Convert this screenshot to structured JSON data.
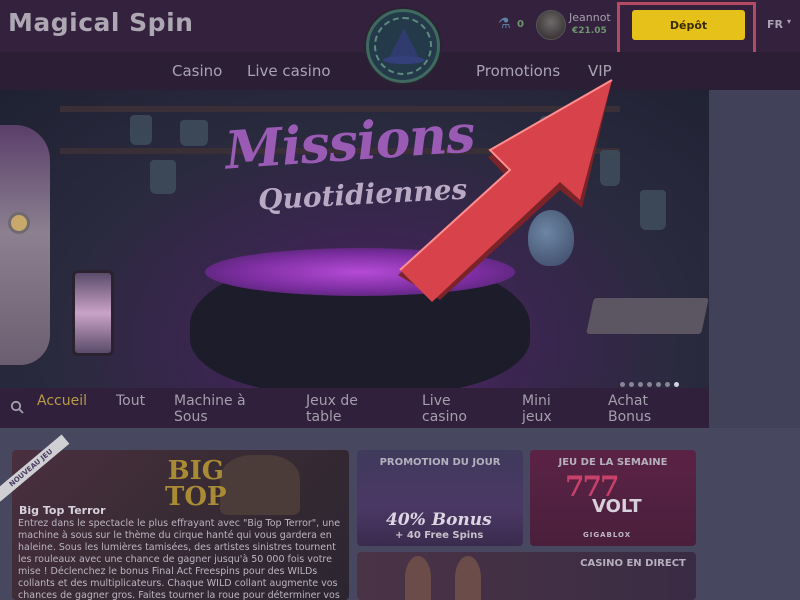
{
  "header": {
    "logo_text": "Magical Spin",
    "balance_count": "0",
    "username": "Jeannot",
    "user_balance": "€21.05",
    "deposit_label": "Dépôt",
    "language": "FR"
  },
  "nav": {
    "items": [
      "Casino",
      "Live casino",
      "Promotions",
      "VIP"
    ]
  },
  "hero": {
    "title_line1": "Missions",
    "title_line2": "Quotidiennes",
    "slide_count": 7,
    "active_slide": 6
  },
  "categories": {
    "items": [
      {
        "label": "Accueil",
        "active": true
      },
      {
        "label": "Tout",
        "active": false
      },
      {
        "label": "Machine à Sous",
        "active": false
      },
      {
        "label": "Jeux de table",
        "active": false
      },
      {
        "label": "Live casino",
        "active": false
      },
      {
        "label": "Mini jeux",
        "active": false
      },
      {
        "label": "Achat Bonus",
        "active": false
      }
    ]
  },
  "featured": {
    "badge": "NOUVEAU JEU",
    "logo_line1": "BIG",
    "logo_line2": "TOP",
    "title": "Big Top Terror",
    "description": "Entrez dans le spectacle le plus effrayant avec \"Big Top Terror\", une machine à sous sur le thème du cirque hanté qui vous gardera en haleine. Sous les lumières tamisées, des artistes sinistres tournent les rouleaux avec une chance de gagner jusqu'à 50 000 fois votre mise ! Déclenchez le bonus Final Act Freespins pour des WILDs collants et des multiplicateurs. Chaque WILD collant augmente vos chances de gagner gros. Faites tourner la roue pour déterminer vos Free Spins et"
  },
  "promo": {
    "label": "PROMOTION DU JOUR",
    "bonus": "40% Bonus",
    "spins": "+ 40 Free Spins"
  },
  "game_of_week": {
    "label": "JEU DE LA SEMAINE",
    "logo_top": "777",
    "logo_bottom": "VOLT",
    "provider": "GIGABLOX"
  },
  "live": {
    "label": "CASINO EN DIRECT"
  },
  "colors": {
    "deposit_button": "#e6c11a",
    "highlight_frame": "#b54a62",
    "annotation_arrow": "#d8434b",
    "active_category": "#b89b45"
  },
  "icons": {
    "search": "search-icon",
    "potion": "potion-icon",
    "arrow": "annotation-arrow"
  }
}
